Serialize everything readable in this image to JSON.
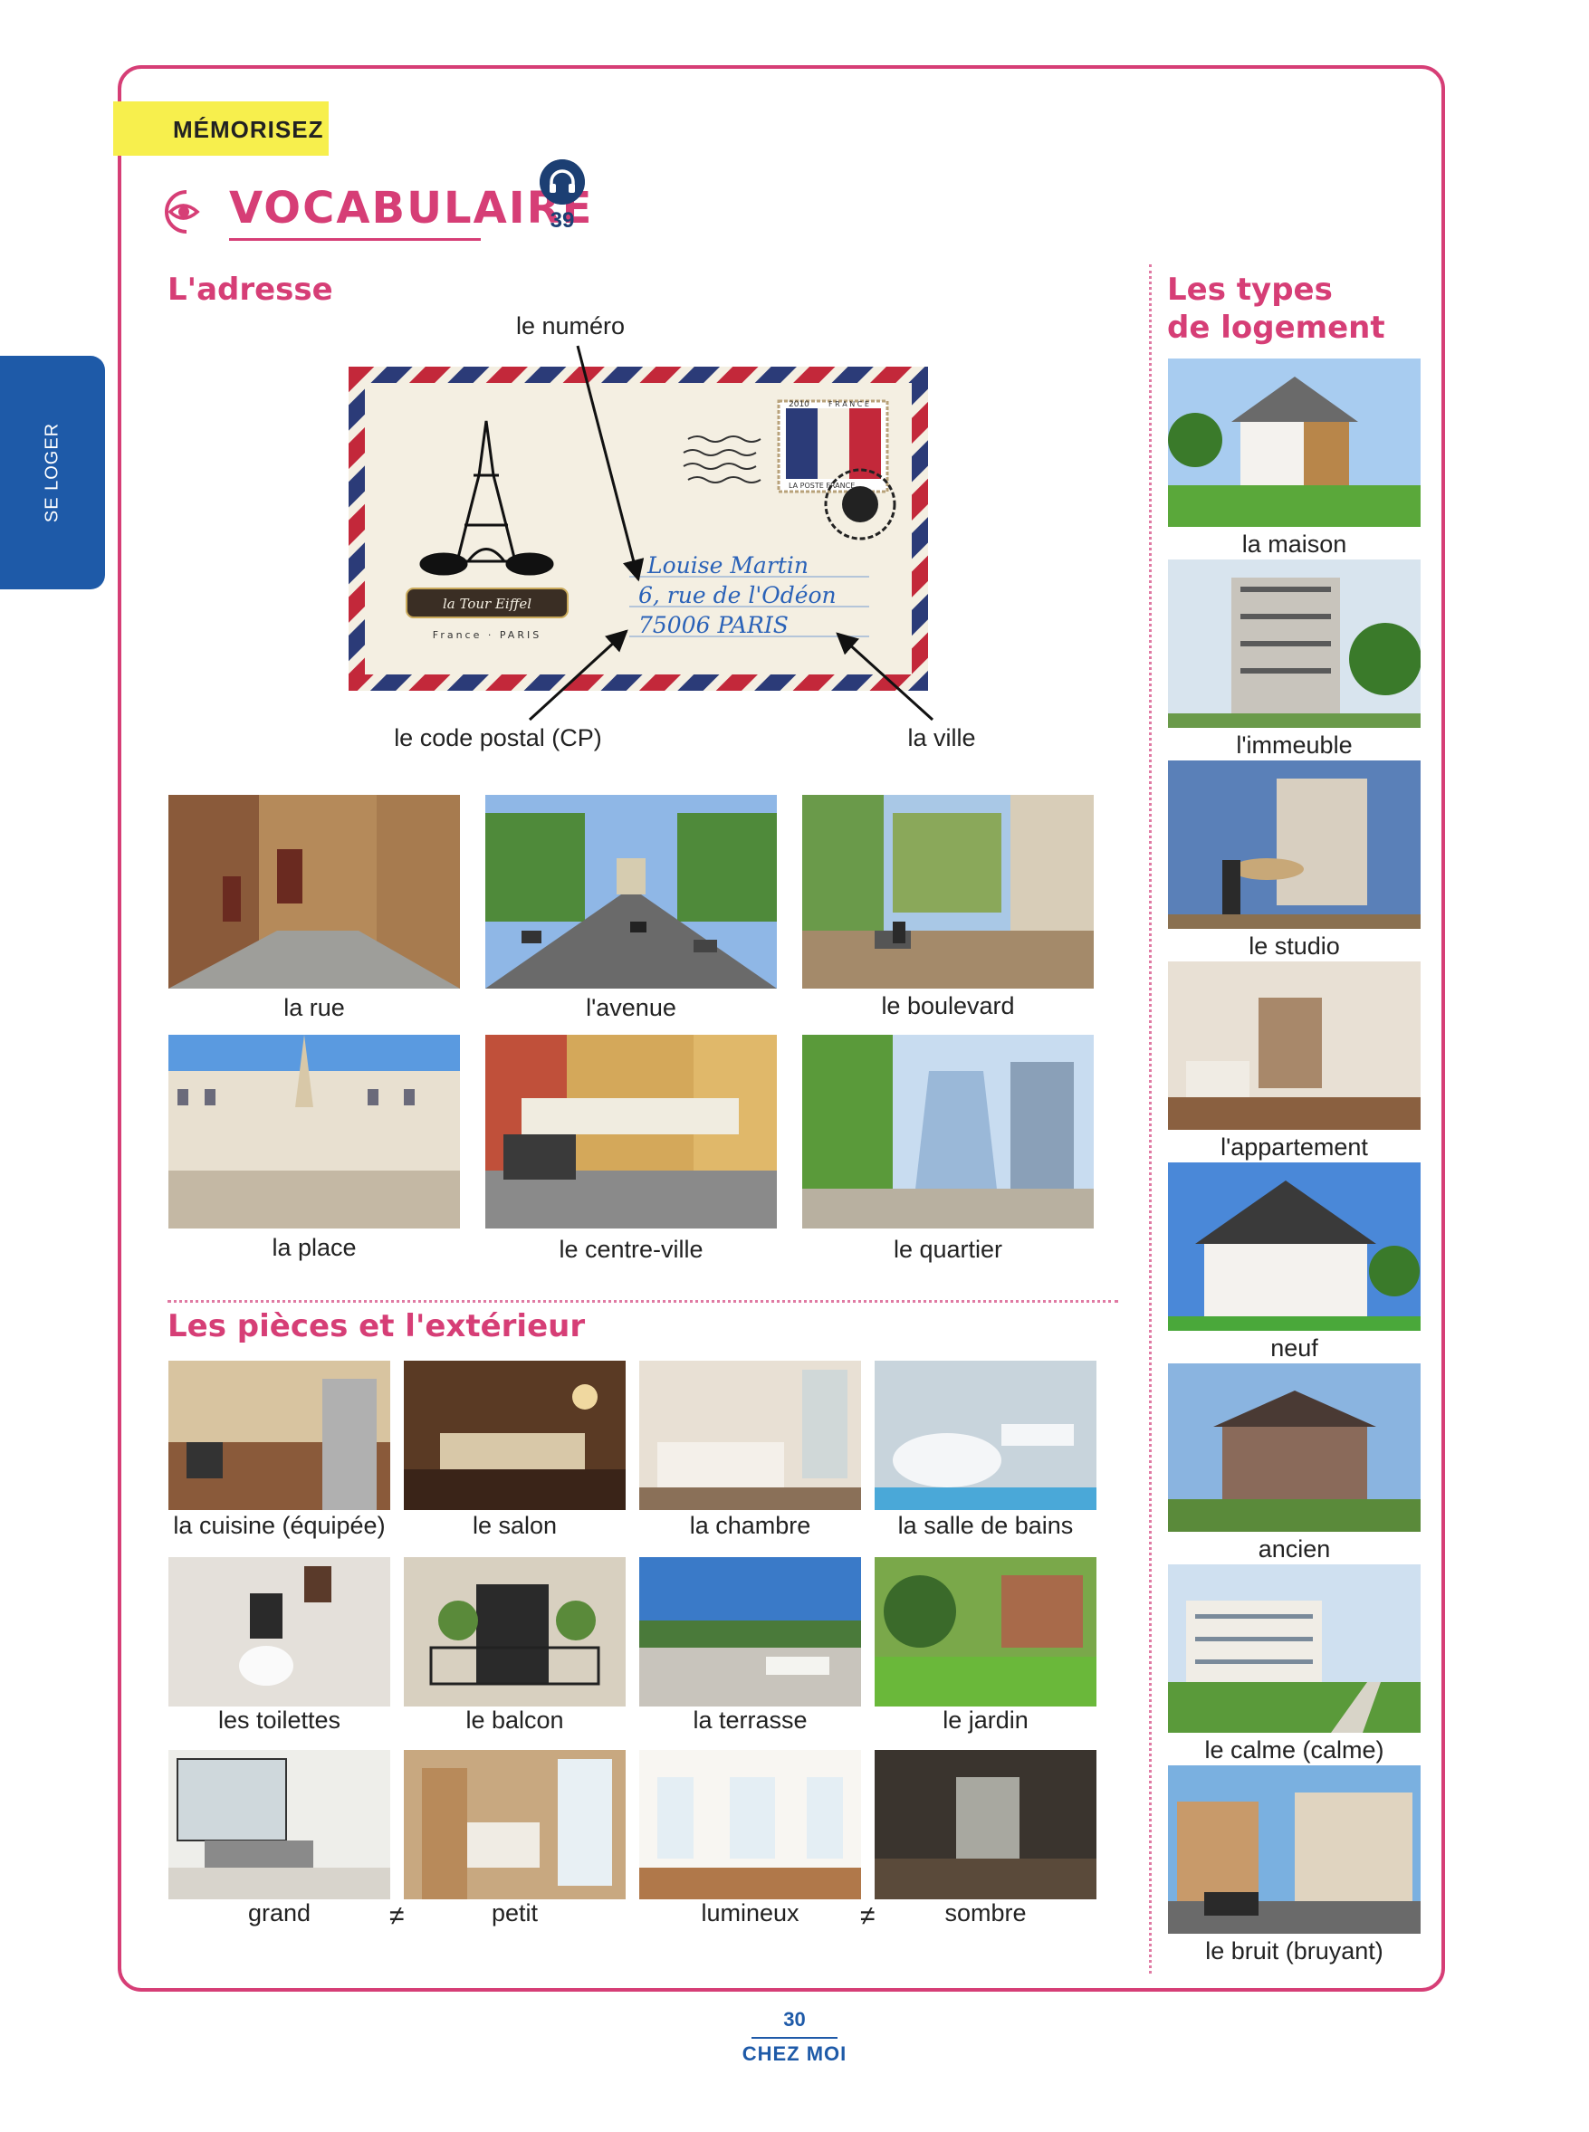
{
  "side_tab": {
    "label": "SE LOGER"
  },
  "memorize": {
    "label": "MÉMORISEZ"
  },
  "vocab": {
    "title": "VOCABULAIRE",
    "audio_track": "39"
  },
  "adresse": {
    "title": "L'adresse",
    "callouts": {
      "numero": "le numéro",
      "code_postal": "le code postal (CP)",
      "ville": "la ville"
    },
    "envelope": {
      "line1": "Louise Martin",
      "line2": "6, rue de l'Odéon",
      "line3": "75006 PARIS",
      "badge": "la Tour Eiffel",
      "badge_sub": "France · PARIS",
      "stamp_year": "2010",
      "stamp_country": "F R A N C E",
      "stamp_text": "LA POSTE FRANCE"
    },
    "places": [
      "la rue",
      "l'avenue",
      "le boulevard",
      "la place",
      "le centre-ville",
      "le quartier"
    ]
  },
  "pieces": {
    "title": "Les pièces et l'extérieur",
    "rooms": [
      "la cuisine (équipée)",
      "le salon",
      "la chambre",
      "la salle de bains",
      "les toilettes",
      "le balcon",
      "la terrasse",
      "le jardin"
    ],
    "opposites": {
      "a": "grand",
      "b": "petit",
      "c": "lumineux",
      "d": "sombre",
      "sign": "≠"
    }
  },
  "types": {
    "title_line1": "Les types",
    "title_line2": "de logement",
    "items": [
      "la maison",
      "l'immeuble",
      "le studio",
      "l'appartement",
      "neuf",
      "ancien",
      "le calme (calme)",
      "le bruit (bruyant)"
    ]
  },
  "footer": {
    "page": "30",
    "chapter": "CHEZ MOI"
  }
}
